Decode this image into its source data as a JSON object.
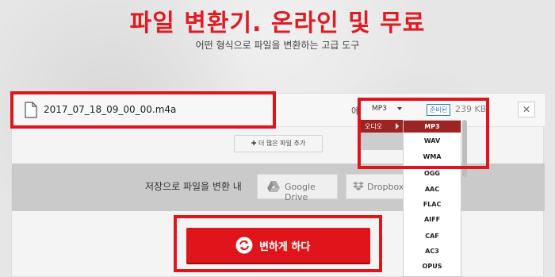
{
  "header": {
    "title": "파일 변환기. 온라인 및 무료",
    "subtitle": "어떤 형식으로 파일을 변환하는 고급 도구"
  },
  "file": {
    "name": "2017_07_18_09_00_00.m4a",
    "to_label": "에",
    "format": "MP3",
    "status": "준비된",
    "size": "239 KB",
    "remove": "✕"
  },
  "add_more": "✚ 더 많은 파일 추가",
  "save": {
    "label": "저장으로 파일을 변환 내",
    "google_drive": "Google Drive",
    "dropbox": "Dropbox"
  },
  "convert": {
    "label": "변하게 하다"
  },
  "dropdown": {
    "category": "오디오",
    "formats": [
      "MP3",
      "WAV",
      "WMA",
      "OGG",
      "AAC",
      "FLAC",
      "AIFF",
      "CAF",
      "AC3",
      "OPUS"
    ],
    "selected": "MP3"
  },
  "colors": {
    "brand_red": "#e0151c",
    "selected_dark_red": "#9e2424",
    "status_blue": "#3a78b8"
  },
  "icons": {
    "file": "file-icon",
    "close": "close-icon",
    "google_drive": "google-drive-icon",
    "dropbox": "dropbox-icon",
    "convert": "refresh-icon",
    "dropdown_caret": "chevron-down-icon",
    "category_arrow": "chevron-right-icon"
  }
}
